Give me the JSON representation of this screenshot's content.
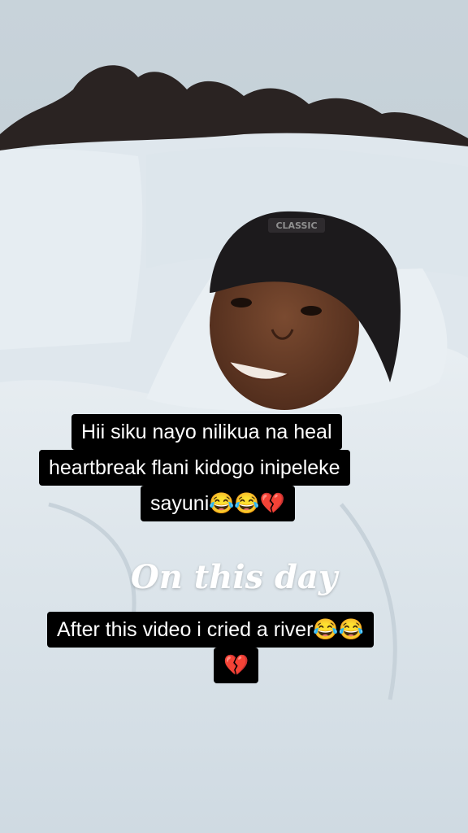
{
  "captions": {
    "top": [
      "Hii siku nayo nilikua na heal",
      "heartbreak flani kidogo inipeleke",
      "sayuni😂😂💔"
    ],
    "title": "On this day",
    "bottom": [
      "After this video i cried a river😂😂",
      "💔"
    ]
  },
  "colors": {
    "caption_bg": "#000000",
    "caption_text": "#ffffff",
    "title_text": "#ffffff",
    "blanket": "#d9e3ea",
    "headboard": "#2a2322",
    "beanie": "#1c1a1c",
    "skin": "#6a3d27"
  },
  "photo": {
    "beanie_text": "CLASSIC"
  }
}
